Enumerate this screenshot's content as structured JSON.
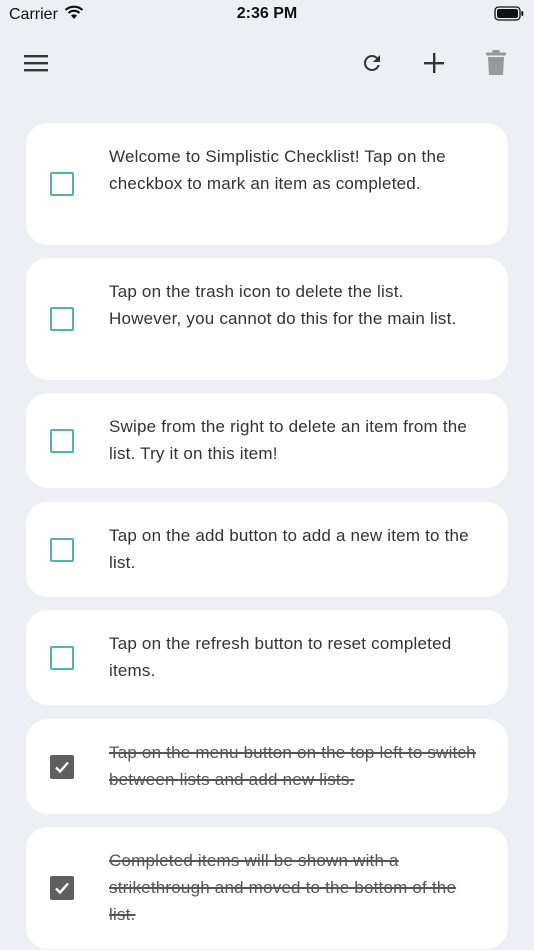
{
  "status": {
    "carrier": "Carrier",
    "time": "2:36 PM"
  },
  "toolbar": {
    "menu_icon": "hamburger-menu-icon",
    "refresh_icon": "refresh-icon",
    "add_icon": "plus-icon",
    "trash_icon": "trash-icon"
  },
  "colors": {
    "checkbox_accent": "#4db6ac",
    "checked_fill": "#5f5f5f",
    "background": "#eeeff4"
  },
  "items": [
    {
      "text": "Welcome to Simplistic Checklist! Tap on the checkbox to mark an item as completed.",
      "completed": false
    },
    {
      "text": "Tap on the trash icon to delete the list. However, you cannot do this for the main list.",
      "completed": false
    },
    {
      "text": "Swipe from the right to delete an item from the list. Try it on this item!",
      "completed": false
    },
    {
      "text": "Tap on the add button to add a new item to the list.",
      "completed": false
    },
    {
      "text": "Tap on the refresh button to reset completed items.",
      "completed": false
    },
    {
      "text": "Tap on the menu button on the top left to switch between lists and add new lists.",
      "completed": true
    },
    {
      "text": "Completed items will be shown with a strikethrough and moved to the bottom of the list.",
      "completed": true
    }
  ]
}
